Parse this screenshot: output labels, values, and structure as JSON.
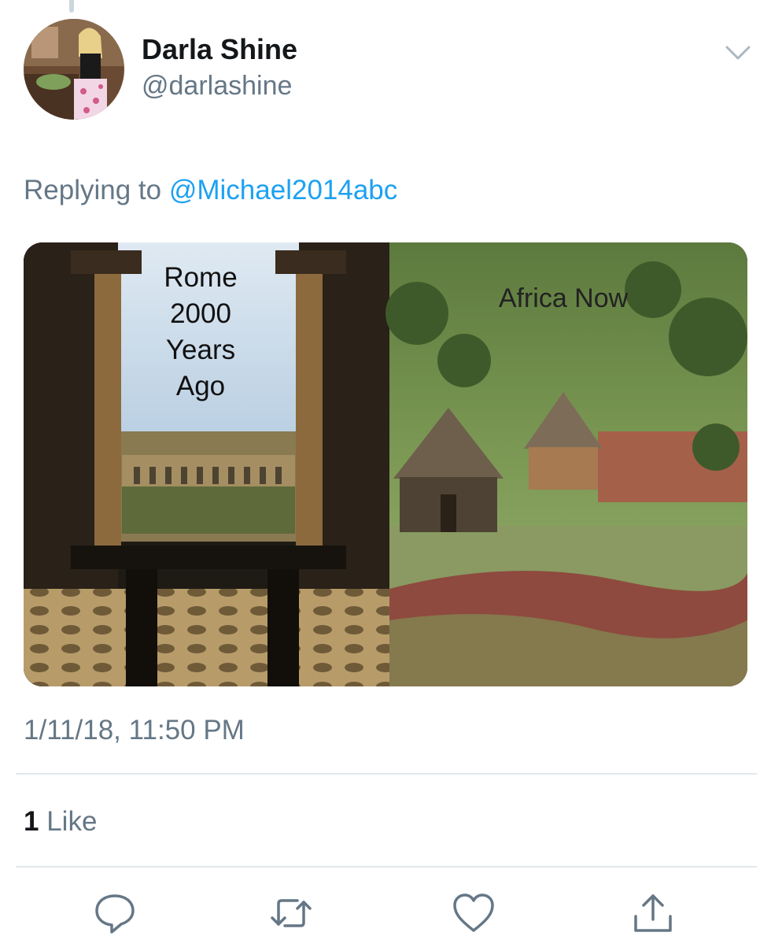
{
  "tweet": {
    "author": {
      "display_name": "Darla Shine",
      "handle": "@darlashine",
      "avatar_icon": "profile-photo"
    },
    "reply": {
      "prefix": "Replying to",
      "mention": "@Michael2014abc"
    },
    "media": {
      "left_caption": "Rome\n2000\nYears\nAgo",
      "right_caption": "Africa Now"
    },
    "timestamp": "1/11/18, 11:50 PM",
    "stats": {
      "like_count": "1",
      "like_label": "Like"
    },
    "actions": [
      {
        "name": "reply",
        "icon": "reply-icon"
      },
      {
        "name": "retweet",
        "icon": "retweet-icon"
      },
      {
        "name": "like",
        "icon": "heart-icon"
      },
      {
        "name": "share",
        "icon": "share-icon"
      }
    ]
  },
  "colors": {
    "text_primary": "#14171a",
    "text_secondary": "#657786",
    "link": "#1da1f2",
    "divider": "#e1e8ed"
  }
}
